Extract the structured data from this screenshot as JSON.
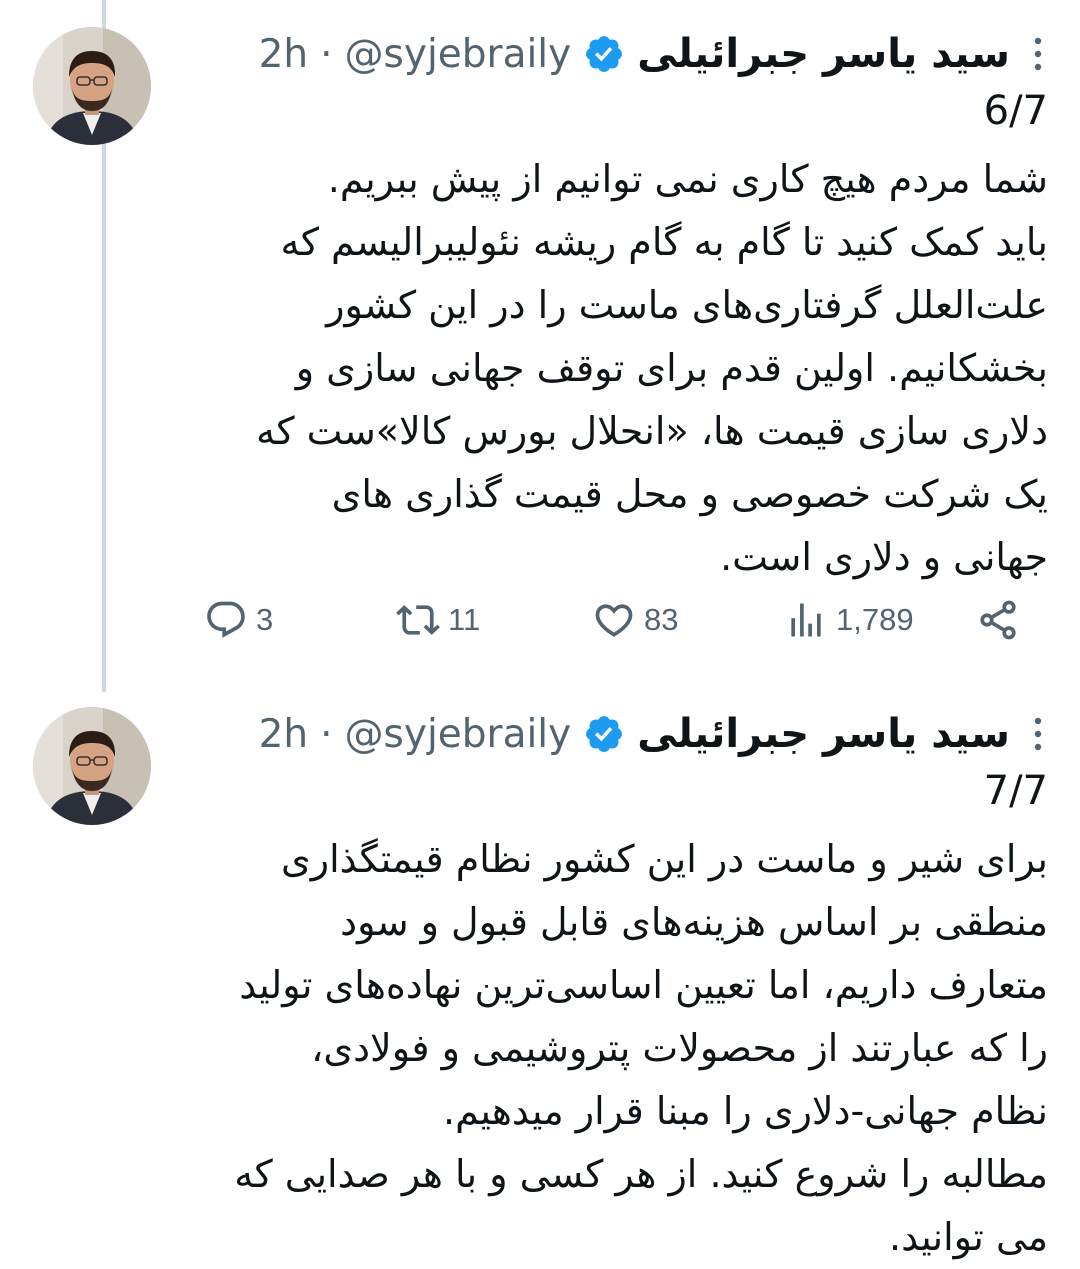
{
  "tweets": [
    {
      "display_name": "سید یاسر جبرائیلی",
      "handle": "@syjebraily",
      "separator": "·",
      "time": "2h",
      "thread_counter": "6/7",
      "text": "شما مردم هیچ کاری نمی توانیم از پیش ببریم.\nباید کمک کنید تا گام به گام ریشه نئولیبرالیسم که\nعلت‌العلل گرفتاری‌های ماست را در این کشور\nبخشکانیم. اولین قدم برای توقف جهانی سازی و\nدلاری سازی قیمت ها، «انحلال بورس کالا»ست که\nیک شرکت خصوصی  و محل قیمت گذاری های\nجهانی و دلاری است.",
      "stats": {
        "replies": "3",
        "retweets": "11",
        "likes": "83",
        "views": "1,789"
      }
    },
    {
      "display_name": "سید یاسر جبرائیلی",
      "handle": "@syjebraily",
      "separator": "·",
      "time": "2h",
      "thread_counter": "7/7",
      "text": "برای شیر و ماست در این کشور نظام قیمتگذاری\nمنطقی بر اساس هزینه‌های قابل قبول و سود\nمتعارف داریم، اما تعیین اساسی‌ترین نهاده‌های تولید\nرا که عبارتند از محصولات پتروشیمی و فولادی،\nنظام جهانی-دلاری را مبنا قرار میدهیم.\nمطالبه را شروع کنید. از هر کسی و با هر صدایی که\nمی توانید."
    }
  ],
  "colors": {
    "text": "#0f1419",
    "secondary": "#536471",
    "verified": "#1d9bf0",
    "thread_line": "#cfd9de"
  },
  "icons": {
    "verified": "verified-badge-icon",
    "more": "more-vertical-icon",
    "reply": "reply-icon",
    "retweet": "retweet-icon",
    "like": "heart-icon",
    "views": "views-chart-icon",
    "share": "share-icon"
  }
}
